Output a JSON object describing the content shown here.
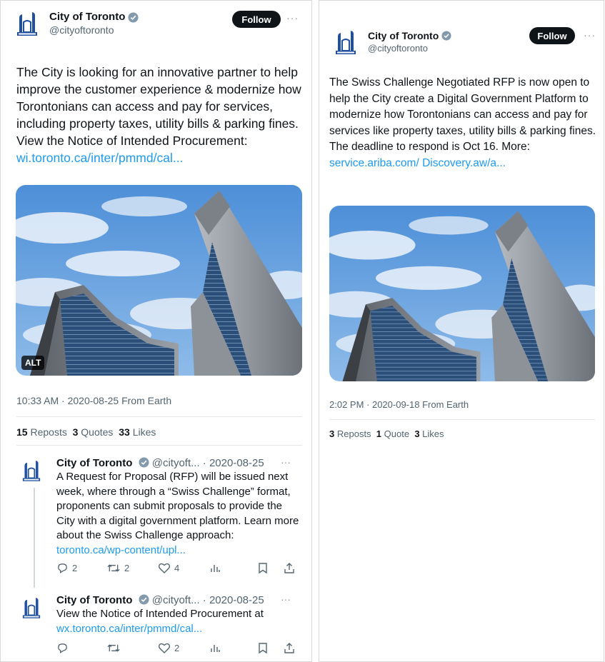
{
  "left": {
    "author": {
      "name": "City of Toronto",
      "handle": "@cityoftoronto"
    },
    "follow_label": "Follow",
    "more": "···",
    "text": "The City is looking for an innovative partner to help improve the customer experience & modernize how Torontonians can access and pay for services, including property taxes, utility bills & parking fines. View the Notice of Intended Procurement: ",
    "link": "wi.toronto.ca/inter/pmmd/cal...",
    "alt_badge": "ALT",
    "timestamp": "10:33 AM · 2020-08-25 From Earth",
    "stats": {
      "reposts_count": "15",
      "reposts_label": "Reposts",
      "quotes_count": "3",
      "quotes_label": "Quotes",
      "likes_count": "33",
      "likes_label": "Likes"
    },
    "replies": [
      {
        "name": "City of Toronto",
        "handle_date": "@cityoft... · 2020-08-25",
        "more": "···",
        "text": "A Request for Proposal (RFP) will be issued next week, where through a “Swiss Challenge” format, proponents can submit proposals to provide the City with a digital government platform. Learn more about the Swiss Challenge approach: ",
        "link": "toronto.ca/wp-content/upl...",
        "replies": "2",
        "reposts": "2",
        "likes": "4"
      },
      {
        "name": "City of Toronto",
        "handle_date": "@cityoft... · 2020-08-25",
        "more": "···",
        "text": "View the Notice of Intended Procurement at ",
        "link": "wx.toronto.ca/inter/pmmd/cal...",
        "replies": "",
        "reposts": "",
        "likes": "2"
      }
    ]
  },
  "right": {
    "author": {
      "name": "City of Toronto",
      "handle": "@cityoftoronto"
    },
    "follow_label": "Follow",
    "more": "···",
    "text": "The Swiss Challenge Negotiated RFP is now open to help the City create a Digital Government Platform to modernize how Torontonians can access and pay for services like property taxes, utility bills & parking fines. The deadline to respond is Oct 16. More: ",
    "link": "service.ariba.com/ Discovery.aw/a...",
    "timestamp": "2:02 PM · 2020-09-18 From Earth",
    "stats": {
      "reposts_count": "3",
      "reposts_label": "Reposts",
      "quotes_count": "1",
      "quotes_label": "Quote",
      "likes_count": "3",
      "likes_label": "Likes"
    }
  },
  "icons": {
    "logo": "city-hall-logo-icon",
    "verified": "verified-badge-icon",
    "reply": "reply-icon",
    "repost": "repost-icon",
    "like": "heart-icon",
    "views": "views-icon",
    "bookmark": "bookmark-icon",
    "share": "share-icon"
  },
  "colors": {
    "link": "#1d9bf0",
    "follow_bg": "#0f1419",
    "secondary_text": "#536471",
    "logo_blue": "#1f4fa0"
  }
}
